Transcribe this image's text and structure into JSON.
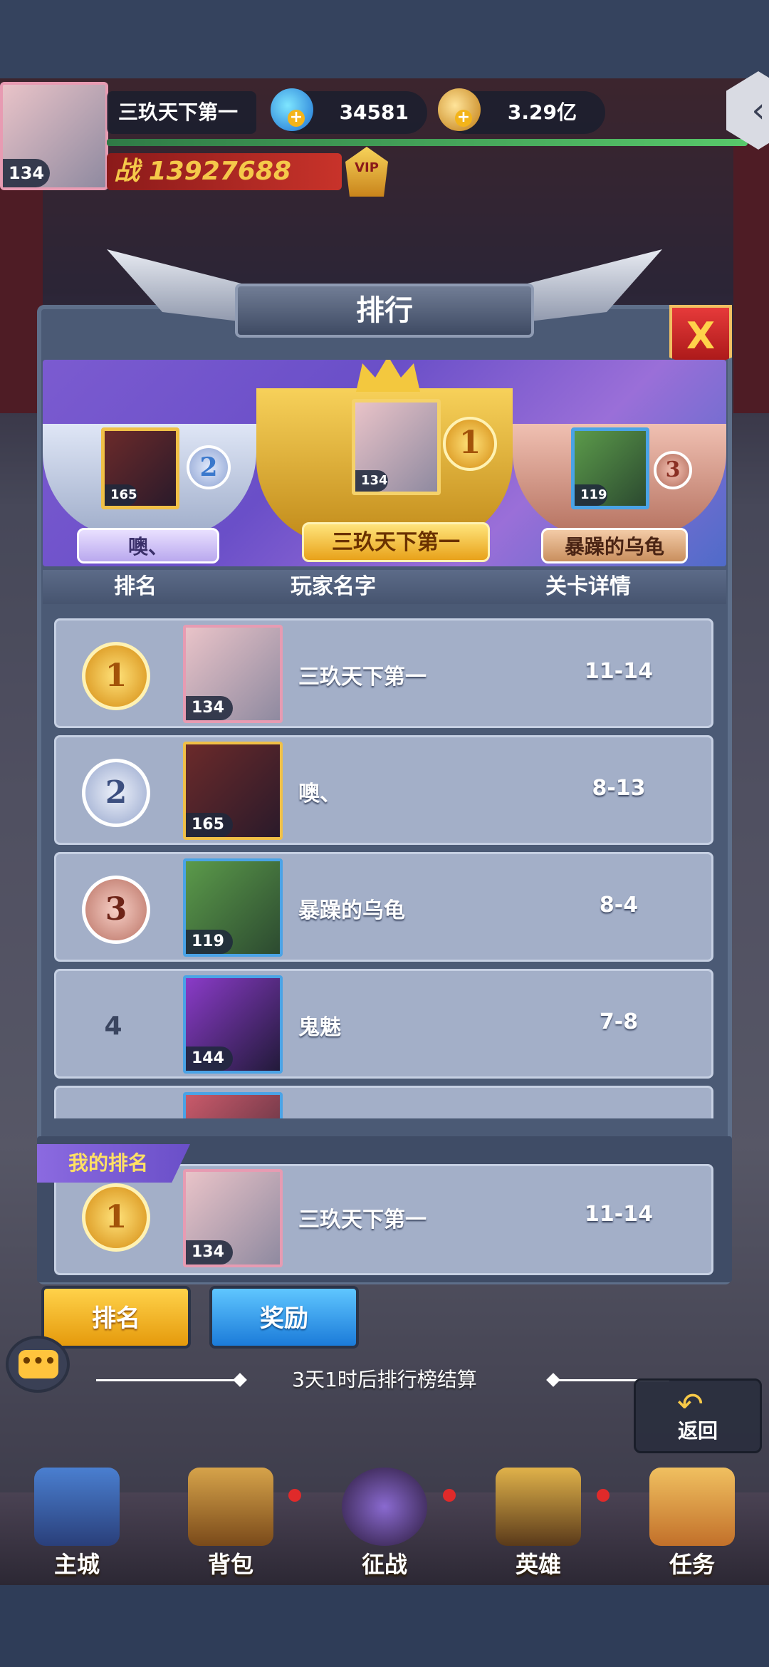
{
  "player": {
    "name": "三玖天下第一",
    "level": "134",
    "gems": "34581",
    "gold": "3.29亿",
    "power_prefix": "战",
    "power": "13927688",
    "vip": "VIP"
  },
  "dialog": {
    "title": "排行",
    "close": "X"
  },
  "podium": [
    {
      "rank": "1",
      "name": "三玖天下第一",
      "level": "134"
    },
    {
      "rank": "2",
      "name": "噢、",
      "level": "165"
    },
    {
      "rank": "3",
      "name": "暴躁的乌龟",
      "level": "119"
    }
  ],
  "list_header": {
    "rank": "排名",
    "player_name": "玩家名字",
    "stage": "关卡详情"
  },
  "rows": [
    {
      "rank": "1",
      "name": "三玖天下第一",
      "level": "134",
      "stage": "11-14"
    },
    {
      "rank": "2",
      "name": "噢、",
      "level": "165",
      "stage": "8-13"
    },
    {
      "rank": "3",
      "name": "暴躁的乌龟",
      "level": "119",
      "stage": "8-4"
    },
    {
      "rank": "4",
      "name": "鬼魅",
      "level": "144",
      "stage": "7-8"
    }
  ],
  "my_rank": {
    "tag": "我的排名",
    "rank": "1",
    "name": "三玖天下第一",
    "level": "134",
    "stage": "11-14"
  },
  "tabs": {
    "rank": "排名",
    "reward": "奖励"
  },
  "settle_text": "3天1时后排行榜结算",
  "return_label": "返回",
  "nav": [
    {
      "label": "主城"
    },
    {
      "label": "背包"
    },
    {
      "label": "征战"
    },
    {
      "label": "英雄"
    },
    {
      "label": "任务"
    }
  ],
  "colors": {
    "gold_medal": "#f3b41a",
    "silver_medal": "#b9c6e6",
    "bronze_medal": "#d88f84",
    "row_bg": "#a3afc8",
    "panel_bg": "#4b5a75"
  }
}
